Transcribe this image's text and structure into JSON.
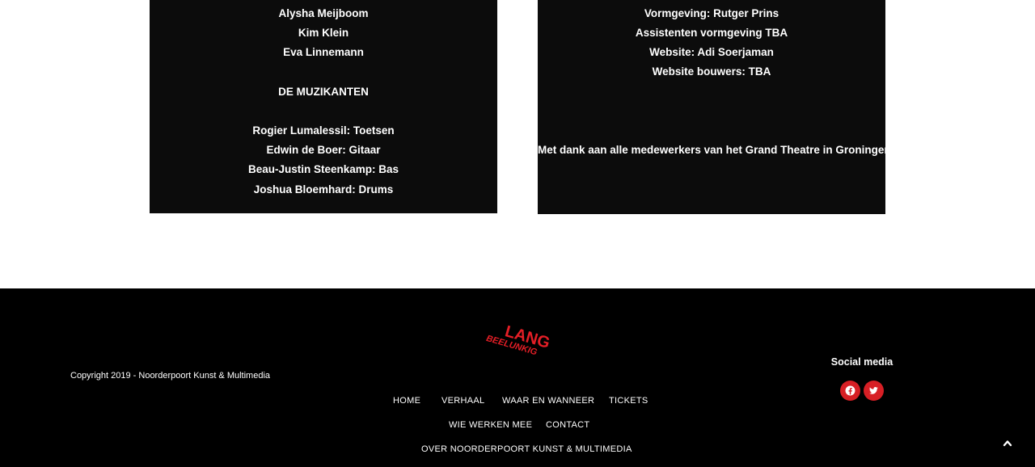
{
  "credits_left": {
    "lines": [
      "Alysha Meijboom",
      "Kim Klein",
      "Eva Linnemann",
      "DE MUZIKANTEN",
      "Rogier Lumalessil: Toetsen",
      "Edwin de Boer: Gitaar",
      "Beau-Justin Steenkamp: Bas",
      "Joshua Bloemhard: Drums"
    ]
  },
  "credits_right": {
    "lines": [
      "Vormgeving: Rutger Prins",
      "Assistenten vormgeving TBA",
      "Website: Adi Soerjaman",
      "Website bouwers: TBA",
      "Met dank aan alle medewerkers van het Grand Theatre in Groningen"
    ]
  },
  "footer": {
    "copyright": "Copyright 2019 - Noorderpoort Kunst & Multimedia",
    "logo": {
      "line1": "LANG",
      "line2": "BEELUNKIG",
      "color": "#e41e26"
    },
    "nav": [
      "HOME",
      "VERHAAL",
      "WAAR EN WANNEER",
      "TICKETS",
      "WIE WERKEN MEE",
      "CONTACT",
      "OVER NOORDERPOORT KUNST & MULTIMEDIA"
    ],
    "social_title": "Social media",
    "social_icons": [
      "facebook-icon",
      "twitter-icon"
    ],
    "accent": "#d71f25"
  }
}
